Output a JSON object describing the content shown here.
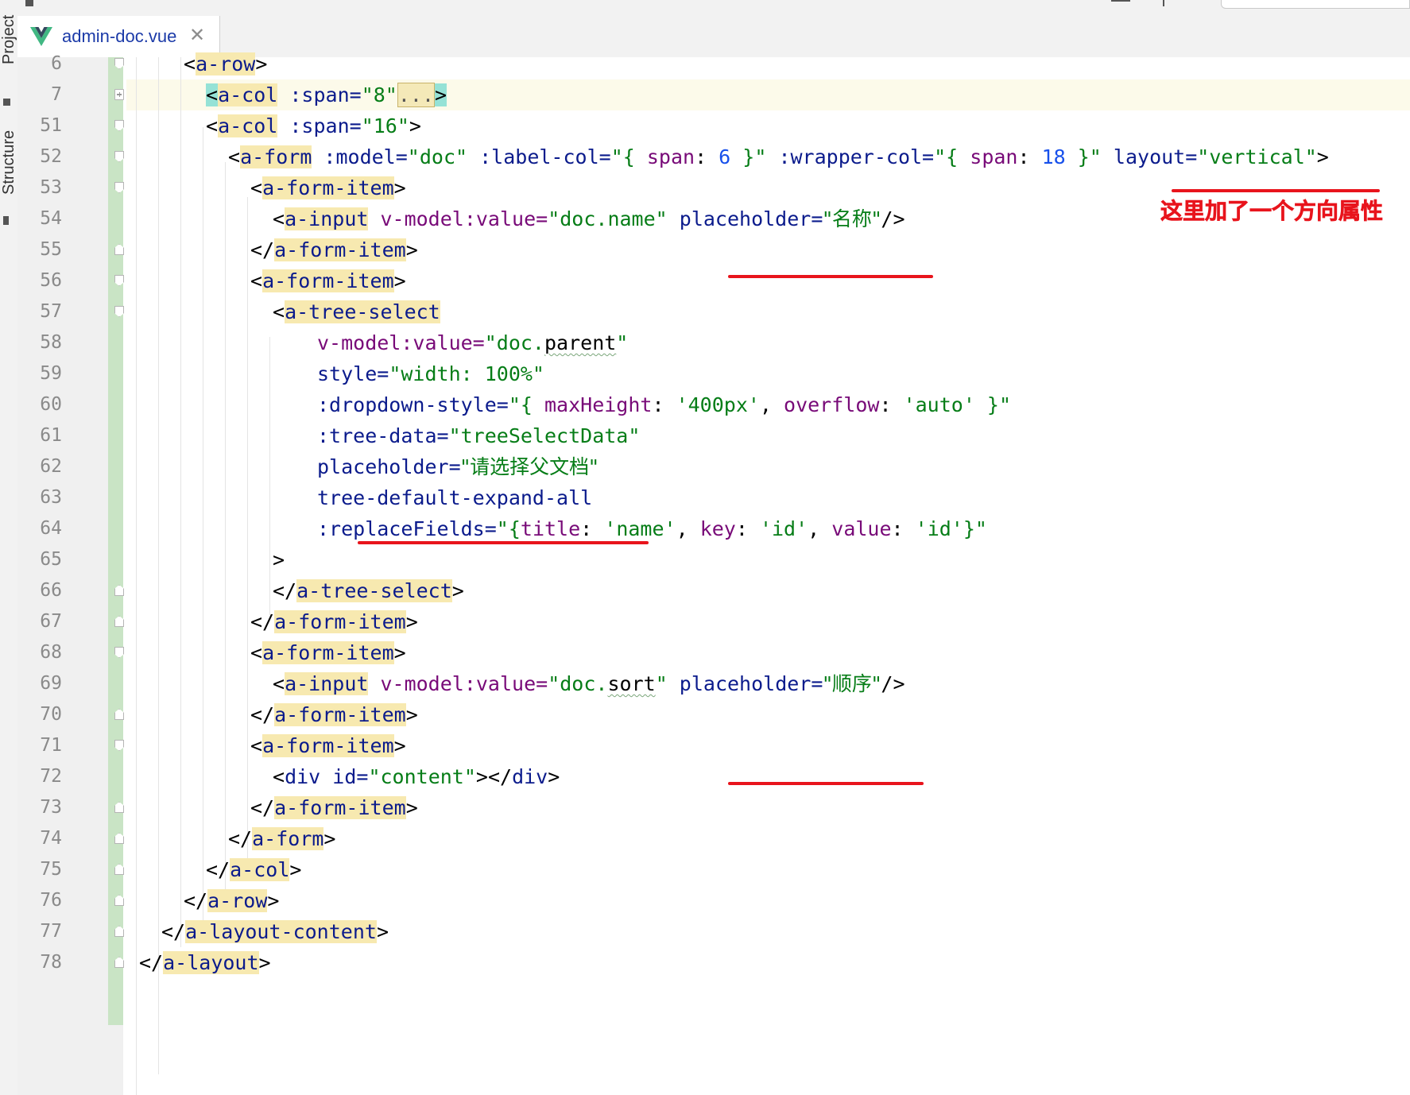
{
  "tab": {
    "filename": "admin-doc.vue"
  },
  "sidebar": {
    "project_label": "Project",
    "structure_label": "Structure"
  },
  "annotation": "这里加了一个方向属性",
  "lines": [
    {
      "n": "6"
    },
    {
      "n": "7"
    },
    {
      "n": "51"
    },
    {
      "n": "52"
    },
    {
      "n": "53"
    },
    {
      "n": "54"
    },
    {
      "n": "55"
    },
    {
      "n": "56"
    },
    {
      "n": "57"
    },
    {
      "n": "58"
    },
    {
      "n": "59"
    },
    {
      "n": "60"
    },
    {
      "n": "61"
    },
    {
      "n": "62"
    },
    {
      "n": "63"
    },
    {
      "n": "64"
    },
    {
      "n": "65"
    },
    {
      "n": "66"
    },
    {
      "n": "67"
    },
    {
      "n": "68"
    },
    {
      "n": "69"
    },
    {
      "n": "70"
    },
    {
      "n": "71"
    },
    {
      "n": "72"
    },
    {
      "n": "73"
    },
    {
      "n": "74"
    },
    {
      "n": "75"
    },
    {
      "n": "76"
    },
    {
      "n": "77"
    },
    {
      "n": "78"
    }
  ],
  "code": {
    "l6": [
      "<",
      "a-row",
      ">"
    ],
    "l7": [
      "<",
      "a-col",
      " :span=",
      "\"8\"",
      "...",
      ">"
    ],
    "l51": [
      "<",
      "a-col",
      " :span=",
      "\"16\"",
      ">"
    ],
    "l52": [
      "<",
      "a-form",
      " :model=",
      "\"doc\"",
      " :label-col=",
      "\"{ ",
      "span",
      ": ",
      "6",
      " }\"",
      " :wrapper-col=",
      "\"{ ",
      "span",
      ": ",
      "18",
      " }\"",
      " layout=",
      "\"vertical\"",
      ">"
    ],
    "l53": [
      "<",
      "a-form-item",
      ">"
    ],
    "l54": [
      "<",
      "a-input",
      " v-model:value=",
      "\"doc.name\"",
      " placeholder=",
      "\"名称\"",
      "/>"
    ],
    "l55": [
      "</",
      "a-form-item",
      ">"
    ],
    "l56": [
      "<",
      "a-form-item",
      ">"
    ],
    "l57": [
      "<",
      "a-tree-select"
    ],
    "l58": [
      "v-model:value=",
      "\"doc.",
      "parent",
      "\""
    ],
    "l59": [
      "style=",
      "\"width: 100%\""
    ],
    "l60": [
      ":dropdown-style=",
      "\"{ ",
      "maxHeight",
      ": ",
      "'400px'",
      ", ",
      "overflow",
      ": ",
      "'auto'",
      " }\""
    ],
    "l61": [
      ":tree-data=",
      "\"treeSelectData\""
    ],
    "l62": [
      "placeholder=",
      "\"请选择父文档\""
    ],
    "l63": [
      "tree-default-expand-all"
    ],
    "l64": [
      ":replaceFields=",
      "\"{",
      "title",
      ": ",
      "'name'",
      ", ",
      "key",
      ": ",
      "'id'",
      ", ",
      "value",
      ": ",
      "'id'",
      "}\""
    ],
    "l65": [
      ">"
    ],
    "l66": [
      "</",
      "a-tree-select",
      ">"
    ],
    "l67": [
      "</",
      "a-form-item",
      ">"
    ],
    "l68": [
      "<",
      "a-form-item",
      ">"
    ],
    "l69": [
      "<",
      "a-input",
      " v-model:value=",
      "\"doc.",
      "sort",
      "\"",
      " placeholder=",
      "\"顺序\"",
      "/>"
    ],
    "l70": [
      "</",
      "a-form-item",
      ">"
    ],
    "l71": [
      "<",
      "a-form-item",
      ">"
    ],
    "l72": [
      "<",
      "div",
      " id=",
      "\"content\"",
      "></",
      "div",
      ">"
    ],
    "l73": [
      "</",
      "a-form-item",
      ">"
    ],
    "l74": [
      "</",
      "a-form",
      ">"
    ],
    "l75": [
      "</",
      "a-col",
      ">"
    ],
    "l76": [
      "</",
      "a-row",
      ">"
    ],
    "l77": [
      "</",
      "a-layout-content",
      ">"
    ],
    "l78": [
      "</",
      "a-layout",
      ">"
    ]
  }
}
